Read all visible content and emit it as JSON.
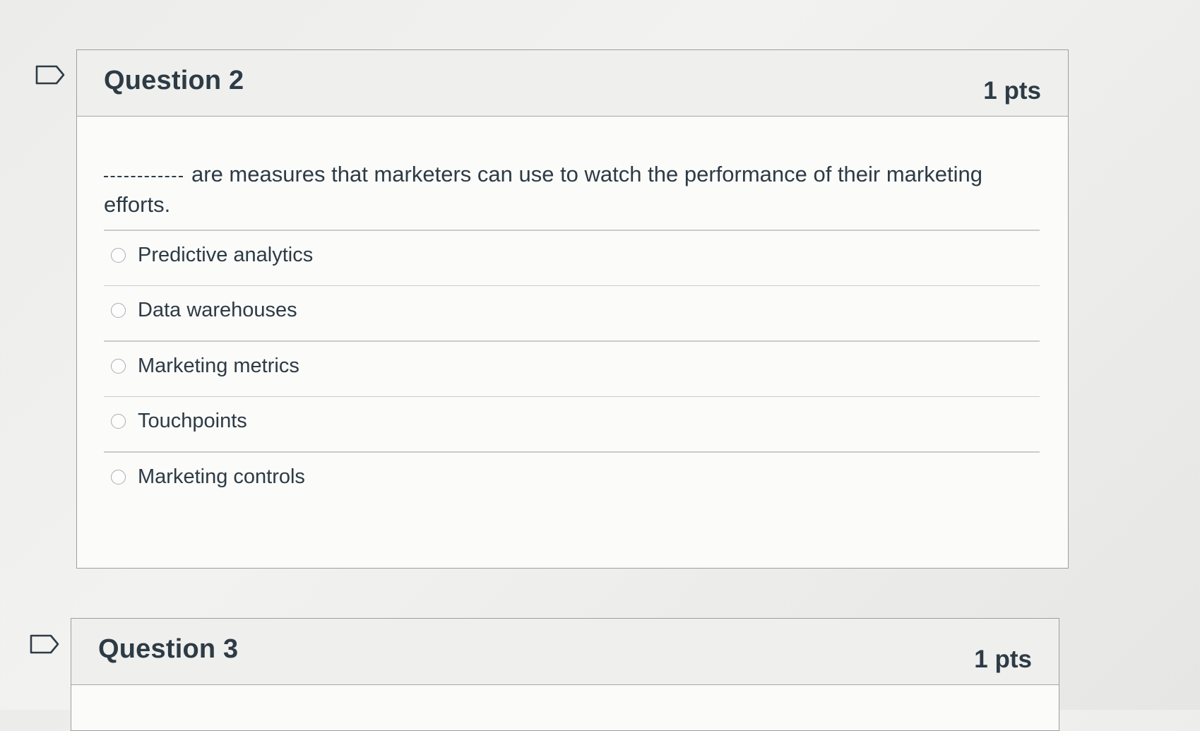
{
  "questions": [
    {
      "title": "Question 2",
      "points": "1 pts",
      "prompt": "are measures that marketers can use to watch the performance of their marketing efforts.",
      "answers": [
        "Predictive analytics",
        "Data warehouses",
        "Marketing metrics",
        "Touchpoints",
        "Marketing controls"
      ]
    },
    {
      "title": "Question 3",
      "points": "1 pts"
    }
  ],
  "icons": {
    "flag": "flag-question-icon",
    "radio": "radio-unselected-icon"
  },
  "colors": {
    "text": "#2d3b45",
    "header_bg": "#efefee",
    "border": "#9aa0a4"
  }
}
